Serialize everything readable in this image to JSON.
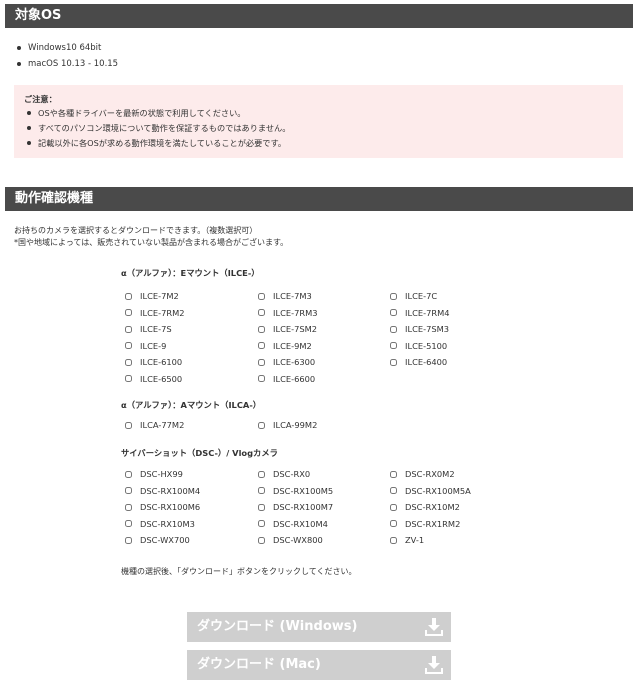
{
  "os_section": {
    "title": "対象OS",
    "items": [
      "Windows10 64bit",
      "macOS 10.13 - 10.15"
    ]
  },
  "notice": {
    "title": "ご注意：",
    "items": [
      "OSや各種ドライバーを最新の状態で利用してください。",
      "すべてのパソコン環境について動作を保証するものではありません。",
      "記載以外に各OSが求める動作環境を満たしていることが必要です。"
    ]
  },
  "models_section": {
    "title": "動作確認機種",
    "intro_line1": "お持ちのカメラを選択するとダウンロードできます。（複数選択可）",
    "intro_line2": "*国や地域によっては、販売されていない製品が含まれる場合がございます。"
  },
  "groups": [
    {
      "title": "α（アルファ）：Eマウント（ILCE-）",
      "models": [
        "ILCE-7M2",
        "ILCE-7M3",
        "ILCE-7C",
        "ILCE-7RM2",
        "ILCE-7RM3",
        "ILCE-7RM4",
        "ILCE-7S",
        "ILCE-7SM2",
        "ILCE-7SM3",
        "ILCE-9",
        "ILCE-9M2",
        "ILCE-5100",
        "ILCE-6100",
        "ILCE-6300",
        "ILCE-6400",
        "ILCE-6500",
        "ILCE-6600"
      ]
    },
    {
      "title": "α（アルファ）：Aマウント（ILCA-）",
      "models": [
        "ILCA-77M2",
        "ILCA-99M2"
      ]
    },
    {
      "title": "サイバーショット（DSC-）/ Vlogカメラ",
      "models": [
        "DSC-HX99",
        "DSC-RX0",
        "DSC-RX0M2",
        "DSC-RX100M4",
        "DSC-RX100M5",
        "DSC-RX100M5A",
        "DSC-RX100M6",
        "DSC-RX100M7",
        "DSC-RX10M2",
        "DSC-RX10M3",
        "DSC-RX10M4",
        "DSC-RX1RM2",
        "DSC-WX700",
        "DSC-WX800",
        "ZV-1"
      ]
    }
  ],
  "instruction": "機種の選択後、「ダウンロード」ボタンをクリックしてください。",
  "buttons": {
    "windows": "ダウンロード (Windows)",
    "mac": "ダウンロード (Mac)"
  },
  "icons": {
    "download": "download-icon"
  },
  "colors": {
    "header_bg": "#4a4a4a",
    "notice_bg": "#fdebeb",
    "button_disabled": "#cfcfcf"
  }
}
